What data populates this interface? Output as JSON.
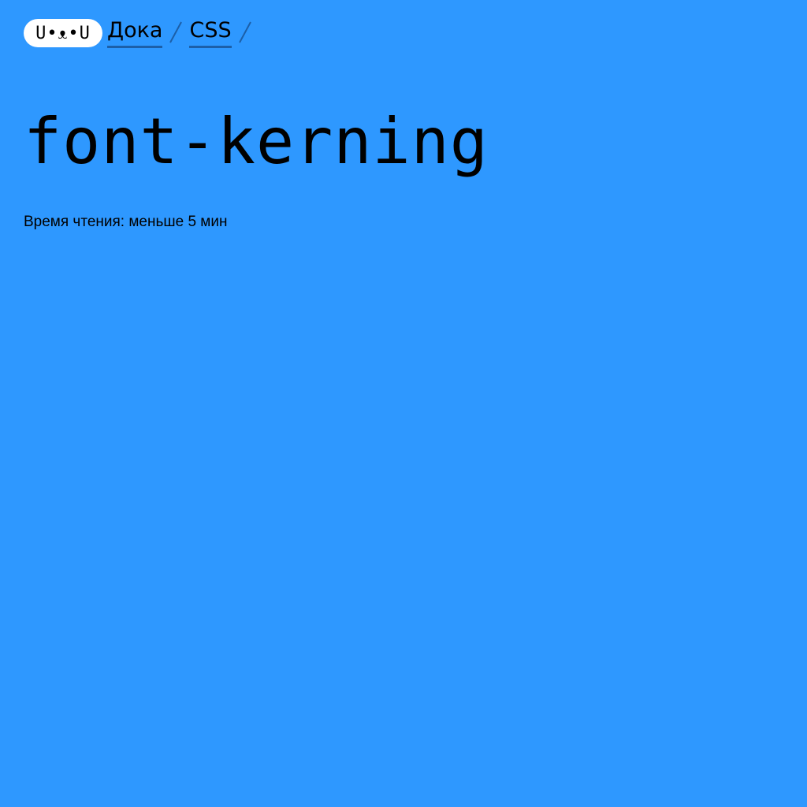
{
  "header": {
    "logo_text": "U•ᴥ•U",
    "breadcrumbs": [
      {
        "label": "Дока"
      },
      {
        "label": "CSS"
      }
    ]
  },
  "article": {
    "title": "font-kerning",
    "reading_time": "Время чтения: меньше 5 мин"
  },
  "colors": {
    "background": "#2e98ff",
    "link_underline": "#1c5fa8",
    "logo_background": "#ffffff"
  }
}
